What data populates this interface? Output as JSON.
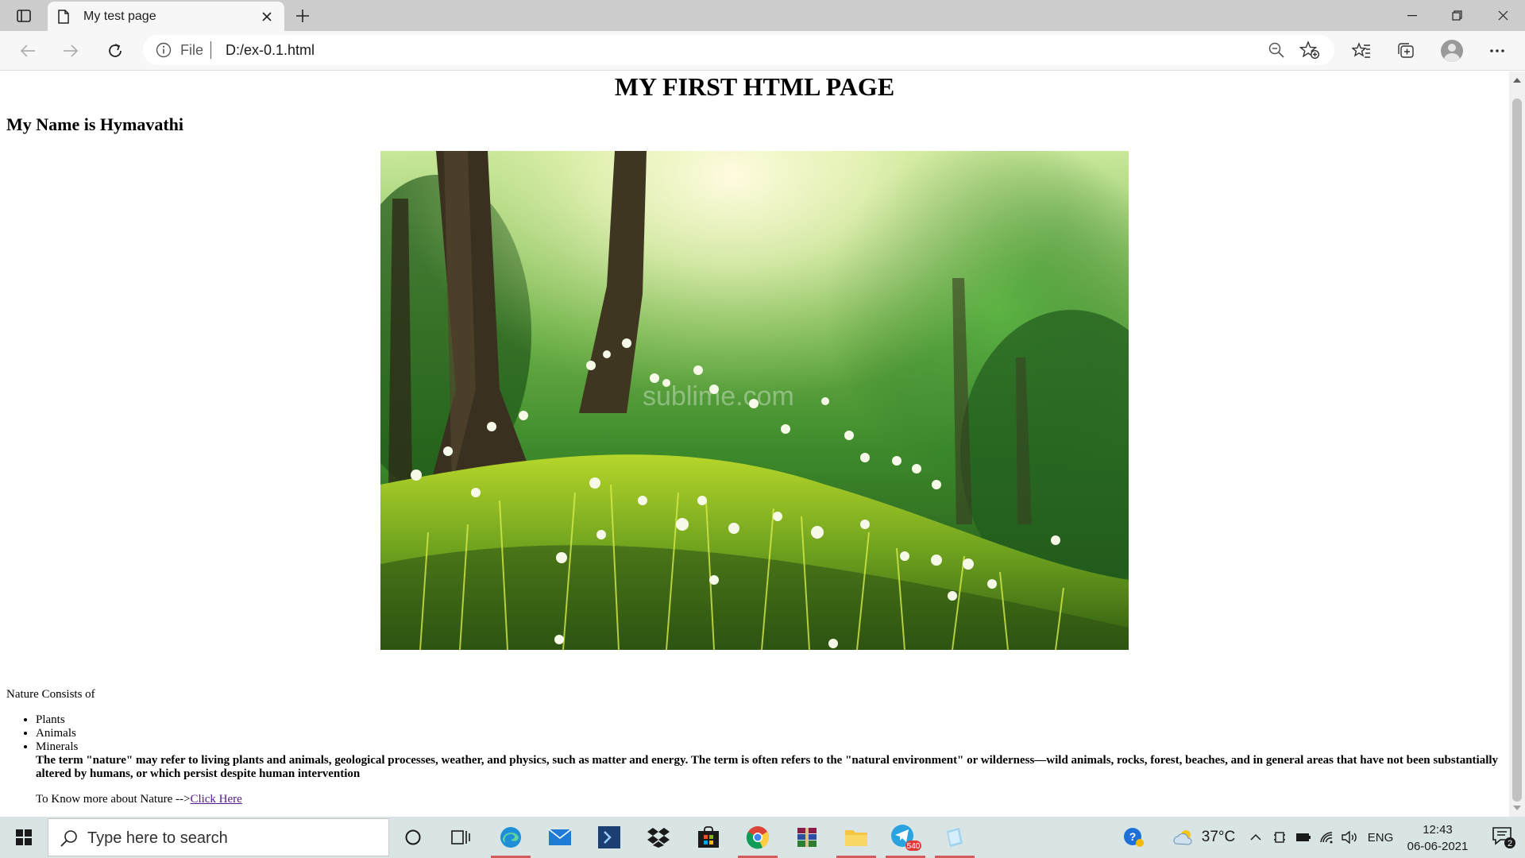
{
  "browser": {
    "tab_title": "My test page",
    "address": {
      "scheme_label": "File",
      "url": "D:/ex-0.1.html"
    }
  },
  "page": {
    "heading": "MY FIRST HTML PAGE",
    "subheading": "My Name is Hymavathi",
    "intro": "Nature Consists of",
    "list": [
      "Plants",
      "Animals",
      "Minerals"
    ],
    "paragraph": "The term \"nature\" may refer to living plants and animals, geological processes, weather, and physics, such as matter and energy. The term is often refers to the \"natural environment\" or wilderness—wild animals, rocks, forest, beaches, and in general areas that have not been substantially altered by humans, or which persist despite human intervention",
    "more_prefix": "To Know more about Nature -->",
    "more_link": "Click Here",
    "image_watermark": "sublime.com"
  },
  "taskbar": {
    "search_placeholder": "Type here to search",
    "weather_temp": "37°C",
    "language": "ENG",
    "time": "12:43",
    "date": "06-06-2021",
    "telegram_badge": "540",
    "notification_count": "2"
  },
  "colors": {
    "tabstrip": "#cccccc",
    "toolbar": "#f7f7f7",
    "taskbar": "#d9e5e5",
    "link_visited": "#551a8b"
  },
  "icons": {
    "tab_actions": "tab-actions-icon",
    "favicon": "page-icon",
    "back": "back-arrow-icon",
    "forward": "forward-arrow-icon",
    "refresh": "refresh-icon",
    "info": "info-icon",
    "zoom": "zoom-out-icon",
    "favorites_add": "star-add-icon",
    "favorites": "favorites-icon",
    "collections": "collections-icon",
    "profile": "profile-avatar",
    "more": "more-icon"
  }
}
